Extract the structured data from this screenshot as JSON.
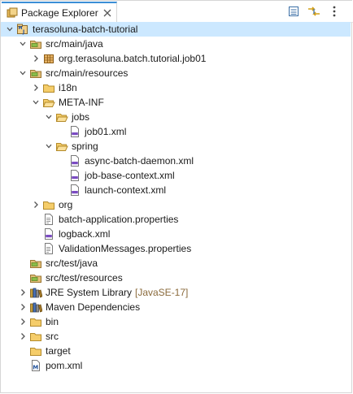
{
  "view": {
    "title": "Package Explorer",
    "toolbar": [
      "collapse-all-icon",
      "link-with-editor-icon",
      "view-menu-icon"
    ]
  },
  "tree": [
    {
      "label": "terasoluna-batch-tutorial",
      "decoration": "",
      "level": 0,
      "expander": "open",
      "icon": "maven-project-icon",
      "selected": true
    },
    {
      "label": "src/main/java",
      "decoration": "",
      "level": 1,
      "expander": "open",
      "icon": "source-folder-icon"
    },
    {
      "label": "org.terasoluna.batch.tutorial.job01",
      "decoration": "",
      "level": 2,
      "expander": "closed",
      "icon": "package-icon"
    },
    {
      "label": "src/main/resources",
      "decoration": "",
      "level": 1,
      "expander": "open",
      "icon": "source-folder-icon"
    },
    {
      "label": "i18n",
      "decoration": "",
      "level": 2,
      "expander": "closed",
      "icon": "folder-icon"
    },
    {
      "label": "META-INF",
      "decoration": "",
      "level": 2,
      "expander": "open",
      "icon": "folder-open-icon"
    },
    {
      "label": "jobs",
      "decoration": "",
      "level": 3,
      "expander": "open",
      "icon": "folder-open-icon"
    },
    {
      "label": "job01.xml",
      "decoration": "",
      "level": 4,
      "expander": "",
      "icon": "xml-file-icon"
    },
    {
      "label": "spring",
      "decoration": "",
      "level": 3,
      "expander": "open",
      "icon": "folder-open-icon"
    },
    {
      "label": "async-batch-daemon.xml",
      "decoration": "",
      "level": 4,
      "expander": "",
      "icon": "xml-file-icon"
    },
    {
      "label": "job-base-context.xml",
      "decoration": "",
      "level": 4,
      "expander": "",
      "icon": "xml-file-icon"
    },
    {
      "label": "launch-context.xml",
      "decoration": "",
      "level": 4,
      "expander": "",
      "icon": "xml-file-icon"
    },
    {
      "label": "org",
      "decoration": "",
      "level": 2,
      "expander": "closed",
      "icon": "folder-icon"
    },
    {
      "label": "batch-application.properties",
      "decoration": "",
      "level": 2,
      "expander": "",
      "icon": "properties-file-icon"
    },
    {
      "label": "logback.xml",
      "decoration": "",
      "level": 2,
      "expander": "",
      "icon": "xml-file-icon"
    },
    {
      "label": "ValidationMessages.properties",
      "decoration": "",
      "level": 2,
      "expander": "",
      "icon": "properties-file-icon"
    },
    {
      "label": "src/test/java",
      "decoration": "",
      "level": 1,
      "expander": "",
      "icon": "source-folder-icon"
    },
    {
      "label": "src/test/resources",
      "decoration": "",
      "level": 1,
      "expander": "",
      "icon": "source-folder-icon"
    },
    {
      "label": "JRE System Library",
      "decoration": "[JavaSE-17]",
      "level": 1,
      "expander": "closed",
      "icon": "library-icon"
    },
    {
      "label": "Maven Dependencies",
      "decoration": "",
      "level": 1,
      "expander": "closed",
      "icon": "library-icon"
    },
    {
      "label": "bin",
      "decoration": "",
      "level": 1,
      "expander": "closed",
      "icon": "folder-icon"
    },
    {
      "label": "src",
      "decoration": "",
      "level": 1,
      "expander": "closed",
      "icon": "folder-icon"
    },
    {
      "label": "target",
      "decoration": "",
      "level": 1,
      "expander": "",
      "icon": "folder-icon"
    },
    {
      "label": "pom.xml",
      "decoration": "",
      "level": 1,
      "expander": "",
      "icon": "pom-file-icon"
    }
  ]
}
